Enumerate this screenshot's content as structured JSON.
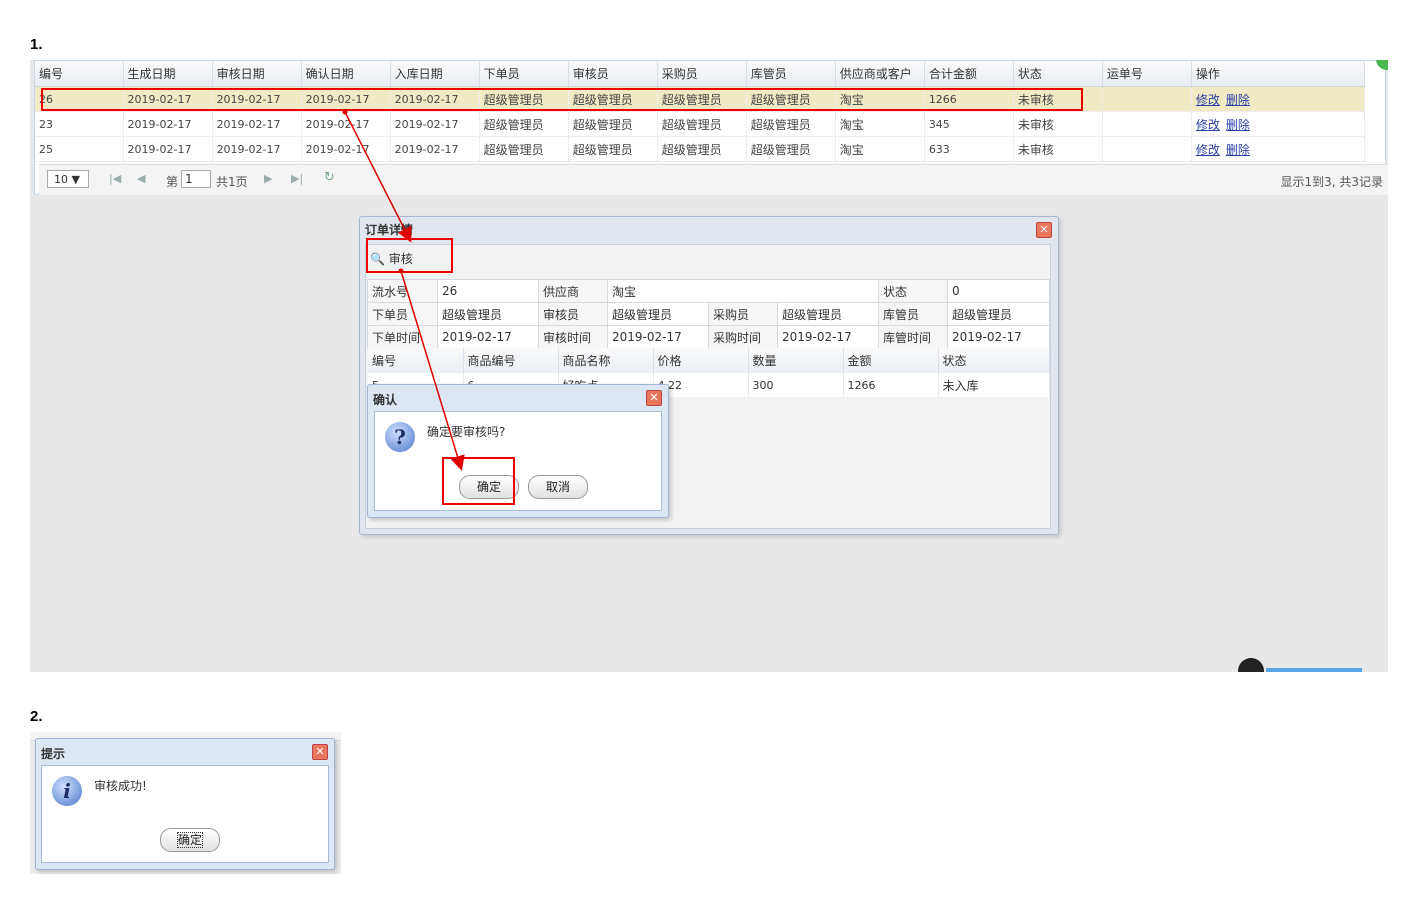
{
  "steps": {
    "step1": "1.",
    "step2": "2."
  },
  "grid": {
    "headers": [
      "编号",
      "生成日期",
      "审核日期",
      "确认日期",
      "入库日期",
      "下单员",
      "审核员",
      "采购员",
      "库管员",
      "供应商或客户",
      "合计金额",
      "状态",
      "运单号",
      "操作"
    ],
    "rows": [
      [
        "26",
        "2019-02-17",
        "2019-02-17",
        "2019-02-17",
        "2019-02-17",
        "超级管理员",
        "超级管理员",
        "超级管理员",
        "超级管理员",
        "淘宝",
        "1266",
        "未审核",
        ""
      ],
      [
        "23",
        "2019-02-17",
        "2019-02-17",
        "2019-02-17",
        "2019-02-17",
        "超级管理员",
        "超级管理员",
        "超级管理员",
        "超级管理员",
        "淘宝",
        "345",
        "未审核",
        ""
      ],
      [
        "25",
        "2019-02-17",
        "2019-02-17",
        "2019-02-17",
        "2019-02-17",
        "超级管理员",
        "超级管理员",
        "超级管理员",
        "超级管理员",
        "淘宝",
        "633",
        "未审核",
        ""
      ]
    ],
    "edit_link": "修改",
    "delete_link": "删除",
    "selected_row": 0
  },
  "pager": {
    "page_size": "10 ▼",
    "page_prefix": "第",
    "page_value": "1",
    "page_suffix": "共1页",
    "info": "显示1到3, 共3记录"
  },
  "detail_window": {
    "title": "订单详情",
    "audit_button": "审核",
    "info": {
      "serial_label": "流水号",
      "serial": "26",
      "supplier_label": "供应商",
      "supplier": "淘宝",
      "status_label": "状态",
      "status": "0",
      "orderer_label": "下单员",
      "orderer": "超级管理员",
      "auditor_label": "审核员",
      "auditor": "超级管理员",
      "buyer_label": "采购员",
      "buyer": "超级管理员",
      "keeper_label": "库管员",
      "keeper": "超级管理员",
      "order_time_label": "下单时间",
      "order_time": "2019-02-17",
      "audit_time_label": "审核时间",
      "audit_time": "2019-02-17",
      "buy_time_label": "采购时间",
      "buy_time": "2019-02-17",
      "keeper_time_label": "库管时间",
      "keeper_time": "2019-02-17"
    },
    "item_headers": [
      "编号",
      "商品编号",
      "商品名称",
      "价格",
      "数量",
      "金额",
      "状态"
    ],
    "item_row": [
      "5",
      "6",
      "好吃点",
      "4.22",
      "300",
      "1266",
      "未入库"
    ]
  },
  "confirm_dialog": {
    "title": "确认",
    "message": "确定要审核吗?",
    "ok": "确定",
    "cancel": "取消"
  },
  "success_dialog": {
    "title": "提示",
    "message": "审核成功!",
    "ok": "确定"
  },
  "colors": {
    "highlight": "#e00000",
    "selected_row": "#f0ebc4",
    "link": "#2a3fa8"
  },
  "icons": {
    "question": "question-icon",
    "info": "info-icon",
    "search": "search-icon",
    "close": "close-icon"
  }
}
